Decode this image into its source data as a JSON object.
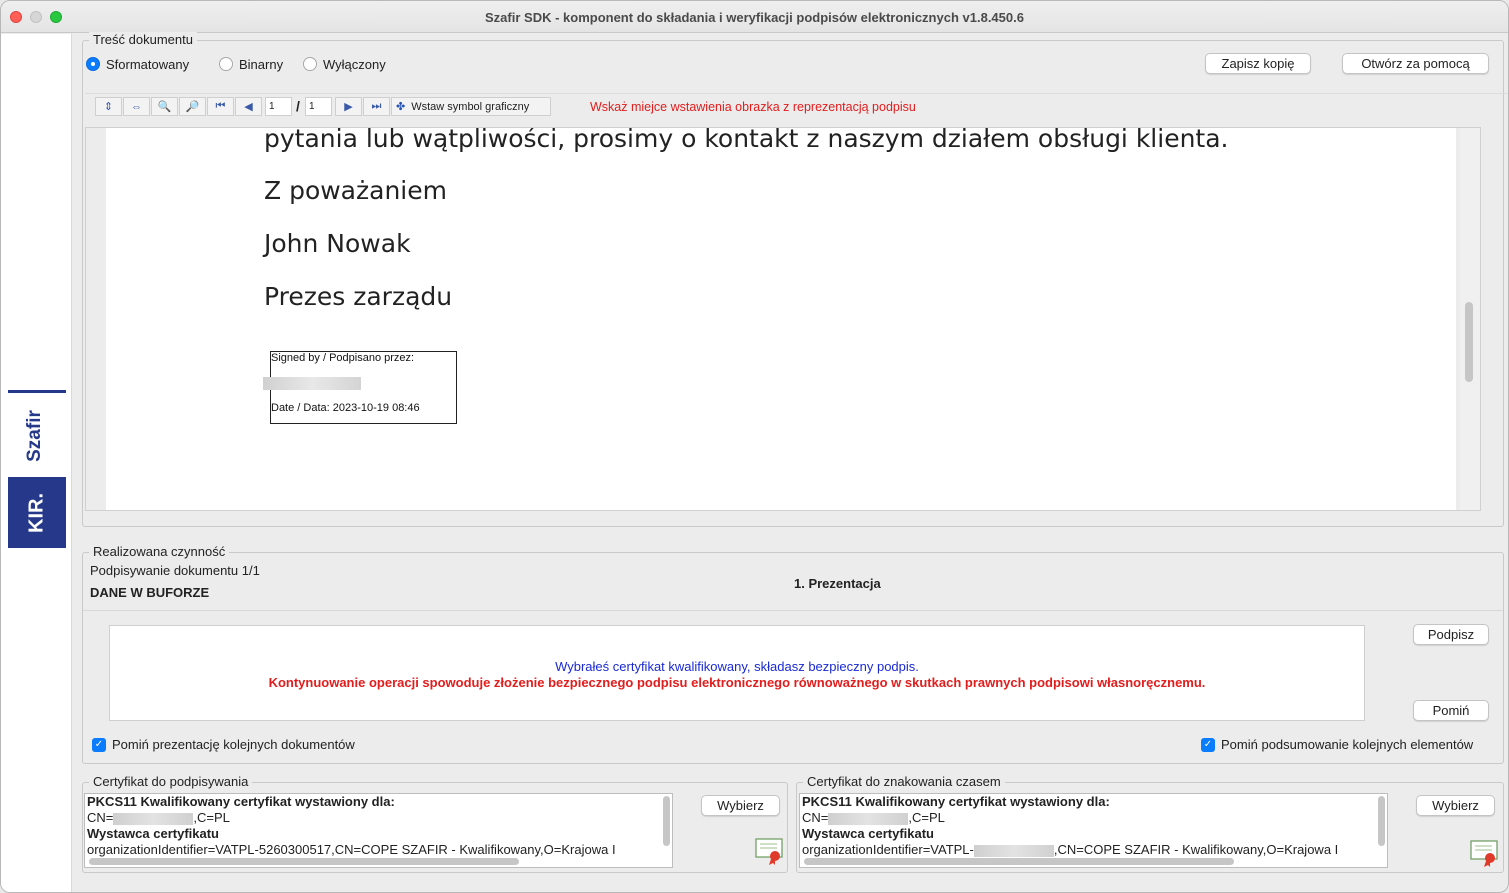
{
  "window": {
    "title": "Szafir SDK - komponent do składania i weryfikacji podpisów elektronicznych v1.8.450.6"
  },
  "sidebar": {
    "logo_top": "Szafir",
    "logo_bottom": "KIR."
  },
  "document": {
    "group_title": "Treść dokumentu",
    "modes": [
      {
        "label": "Sformatowany",
        "selected": true
      },
      {
        "label": "Binarny",
        "selected": false
      },
      {
        "label": "Wyłączony",
        "selected": false
      }
    ],
    "save_copy_label": "Zapisz kopię",
    "open_with_label": "Otwórz za pomocą",
    "toolbar": {
      "page_current": "1",
      "page_separator": "/",
      "page_total": "1",
      "insert_symbol_label": "Wstaw symbol graficzny",
      "hint": "Wskaż miejce wstawienia obrazka z reprezentacją podpisu"
    },
    "content_lines": [
      "pytania lub wątpliwości, prosimy o kontakt z naszym działem obsługi klienta.",
      "Z poważaniem",
      "John Nowak",
      "Prezes zarządu"
    ],
    "signature": {
      "signed_by": "Signed by / Podpisano przez:",
      "date": "Date / Data: 2023-10-19 08:46"
    }
  },
  "operation": {
    "group_title": "Realizowana czynność",
    "label": "Podpisywanie dokumentu 1/1",
    "buffer": "DANE W BUFORZE",
    "step": "1. Prezentacja",
    "message_info": "Wybrałeś certyfikat kwalifikowany, składasz bezpieczny podpis.",
    "message_warning": "Kontynuowanie operacji spowoduje złożenie bezpiecznego podpisu elektronicznego równoważnego w skutkach prawnych podpisowi własnoręcznemu.",
    "sign_label": "Podpisz",
    "skip_label": "Pomiń",
    "skip_presentation_label": "Pomiń prezentację kolejnych dokumentów",
    "skip_summary_label": "Pomiń podsumowanie kolejnych elementów"
  },
  "cert_sign": {
    "group_title": "Certyfikat do podpisywania",
    "line1": "PKCS11 Kwalifikowany certyfikat wystawiony dla:",
    "line2_prefix": "CN=",
    "line2_suffix": ",C=PL",
    "line3": "Wystawca certyfikatu",
    "line4": "organizationIdentifier=VATPL-5260300517,CN=COPE SZAFIR - Kwalifikowany,O=Krajowa I",
    "choose_label": "Wybierz"
  },
  "cert_time": {
    "group_title": "Certyfikat do znakowania czasem",
    "line1": "PKCS11 Kwalifikowany certyfikat wystawiony dla:",
    "line2_prefix": "CN=",
    "line2_suffix": ",C=PL",
    "line3": "Wystawca certyfikatu",
    "line4_prefix": "organizationIdentifier=VATPL-",
    "line4_suffix": ",CN=COPE SZAFIR - Kwalifikowany,O=Krajowa I",
    "choose_label": "Wybierz"
  },
  "colors": {
    "brand": "#25388a",
    "accent": "#0a7cff",
    "warning": "#e21d1d",
    "info": "#1a2ad6"
  }
}
